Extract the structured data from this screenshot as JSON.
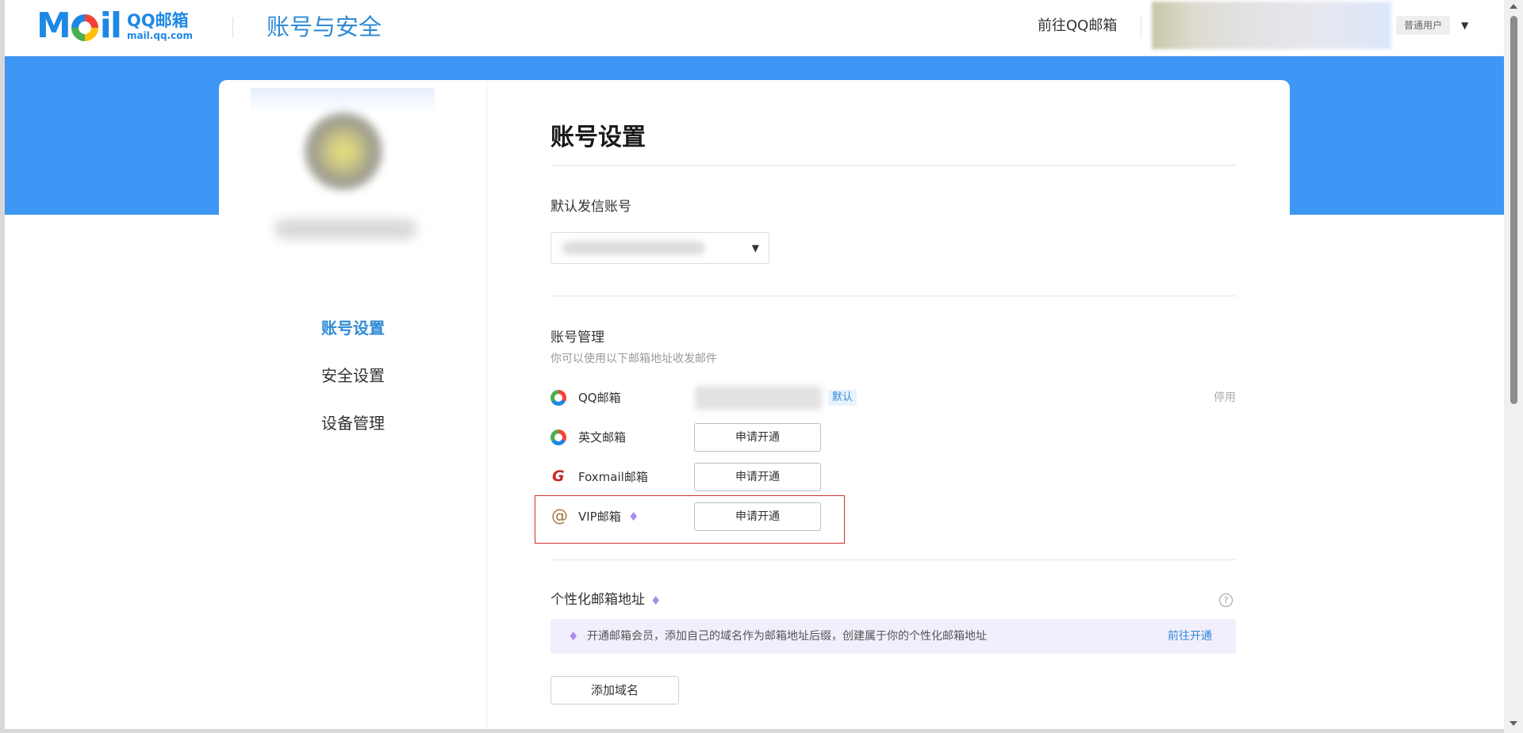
{
  "header": {
    "logo_mark_left": "M",
    "logo_mark_right": "il",
    "logo_cn": "QQ邮箱",
    "logo_url": "mail.qq.com",
    "title": "账号与安全",
    "goto_qq": "前往QQ邮箱",
    "user_badge": "普通用户",
    "caret": "▼"
  },
  "sidebar": {
    "items": [
      {
        "label": "账号设置",
        "active": true
      },
      {
        "label": "安全设置",
        "active": false
      },
      {
        "label": "设备管理",
        "active": false
      }
    ]
  },
  "main": {
    "page_title": "账号设置",
    "default_sender": {
      "label": "默认发信账号",
      "arrow": "▼"
    },
    "account_mgmt": {
      "label": "账号管理",
      "sub": "你可以使用以下邮箱地址收发邮件",
      "rows": [
        {
          "name": "QQ邮箱",
          "icon": "qq-mail-ring-icon",
          "tag": "默认",
          "action": "停用"
        },
        {
          "name": "英文邮箱",
          "icon": "english-mail-ring-icon",
          "button": "申请开通"
        },
        {
          "name": "Foxmail邮箱",
          "icon": "foxmail-icon",
          "icon_glyph": "G",
          "button": "申请开通"
        },
        {
          "name": "VIP邮箱",
          "icon": "at-icon",
          "icon_glyph": "@",
          "button": "申请开通"
        }
      ]
    },
    "custom_address": {
      "label": "个性化邮箱地址",
      "help": "?",
      "banner_text": "开通邮箱会员，添加自己的域名作为邮箱地址后缀，创建属于你的个性化邮箱地址",
      "banner_link": "前往开通",
      "add_domain": "添加域名"
    },
    "diamond_glyph": "♦"
  },
  "colors": {
    "brand_blue": "#3e96f5",
    "link_blue": "#2f8bd6",
    "vip_purple": "#a98cf0",
    "highlight_red": "#d32f2f"
  }
}
